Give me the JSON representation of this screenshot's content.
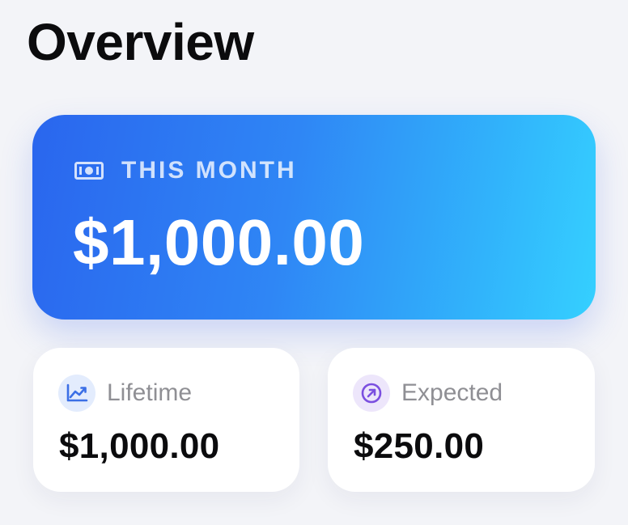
{
  "header": {
    "title": "Overview"
  },
  "this_month": {
    "icon": "money-icon",
    "label": "THIS MONTH",
    "amount": "$1,000.00"
  },
  "stats": {
    "lifetime": {
      "icon": "trend-chart-icon",
      "label": "Lifetime",
      "amount": "$1,000.00"
    },
    "expected": {
      "icon": "arrow-up-right-icon",
      "label": "Expected",
      "amount": "$250.00"
    }
  },
  "colors": {
    "background": "#f3f4f8",
    "hero_gradient_start": "#2a66ee",
    "hero_gradient_end": "#35d0ff",
    "lifetime_icon": "#3b6fe6",
    "expected_icon": "#7b4fe0"
  }
}
